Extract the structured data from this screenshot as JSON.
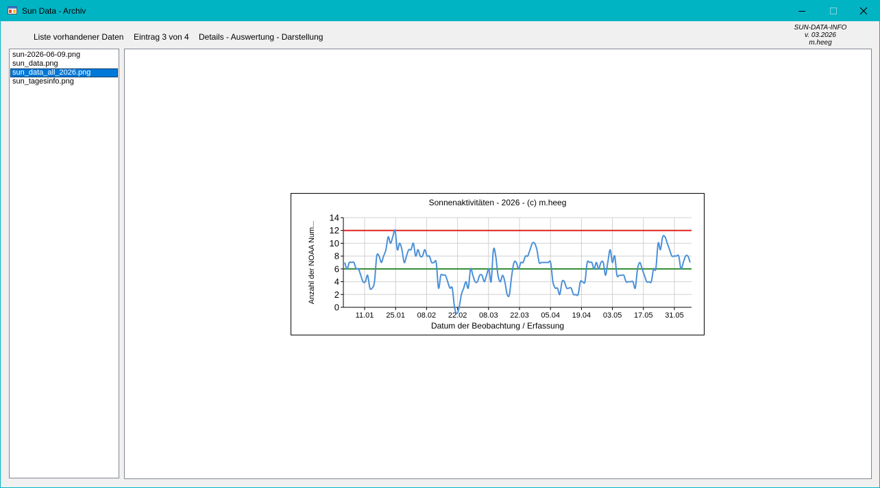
{
  "window": {
    "title": "Sun Data - Archiv",
    "icon": "app-window-icon",
    "controls": [
      "minimize-icon",
      "maximize-icon",
      "close-icon"
    ],
    "accent_color": "#00b4c4"
  },
  "menu": {
    "list_label": "Liste vorhandener Daten",
    "entry_label": "Eintrag 3 von 4",
    "details_label": "Details - Auswertung - Darstellung"
  },
  "info": {
    "line1": "SUN-DATA-INFO",
    "line2": "v. 03.2026",
    "line3": "m.heeg"
  },
  "files": [
    {
      "name": "sun-2026-06-09.png",
      "selected": false
    },
    {
      "name": "sun_data.png",
      "selected": false
    },
    {
      "name": "sun_data_all_2026.png",
      "selected": true
    },
    {
      "name": "sun_tagesinfo.png",
      "selected": false
    }
  ],
  "chart_data": {
    "type": "line",
    "title": "Sonnenaktivitäten - 2026 - (c) m.heeg",
    "xlabel": "Datum der Beobachtung / Erfassung",
    "ylabel": "Anzahl der NOAA Num...",
    "ylim": [
      0,
      14
    ],
    "yticks": [
      0,
      2,
      4,
      6,
      8,
      10,
      12,
      14
    ],
    "xticks": [
      "11.01",
      "25.01",
      "08.02",
      "22.02",
      "08.03",
      "22.03",
      "05.04",
      "19.04",
      "03.05",
      "17.05",
      "31.05"
    ],
    "grid": true,
    "series": [
      {
        "color": "#4a90d9",
        "values": [
          7,
          6,
          7,
          7,
          7,
          6,
          6,
          5,
          4,
          4,
          5,
          3,
          3,
          4,
          8,
          8,
          7,
          8,
          9,
          11,
          10,
          11,
          12,
          9,
          10,
          9,
          7,
          8,
          9,
          9,
          10,
          8,
          9,
          8,
          8,
          9,
          8,
          8,
          7,
          7,
          7,
          3,
          5,
          5,
          5,
          4,
          3,
          3,
          0,
          -1,
          0,
          2,
          3,
          4,
          3,
          6,
          5,
          4,
          4,
          5,
          5,
          4,
          5,
          6,
          4,
          9,
          8,
          5,
          4,
          5,
          4,
          2,
          2,
          5,
          7,
          7,
          6,
          7,
          7,
          8,
          8,
          9,
          10,
          10,
          9,
          7,
          7,
          7,
          7,
          7,
          7,
          4,
          3,
          3,
          2,
          4,
          4,
          3,
          3,
          3,
          2,
          2,
          2,
          4,
          4,
          4,
          7,
          7,
          7,
          6,
          7,
          6,
          7,
          7,
          5,
          7,
          9,
          7,
          8,
          5,
          5,
          5,
          5,
          4,
          4,
          4,
          4,
          3,
          6,
          7,
          6,
          5,
          4,
          4,
          4,
          6,
          6,
          10,
          9,
          11,
          11,
          10,
          9,
          8,
          8,
          8,
          8,
          6,
          7,
          8,
          8,
          7
        ]
      },
      {
        "color": "#e02020",
        "values": [
          12
        ]
      },
      {
        "color": "#2e8b2e",
        "values": [
          6
        ]
      }
    ]
  }
}
